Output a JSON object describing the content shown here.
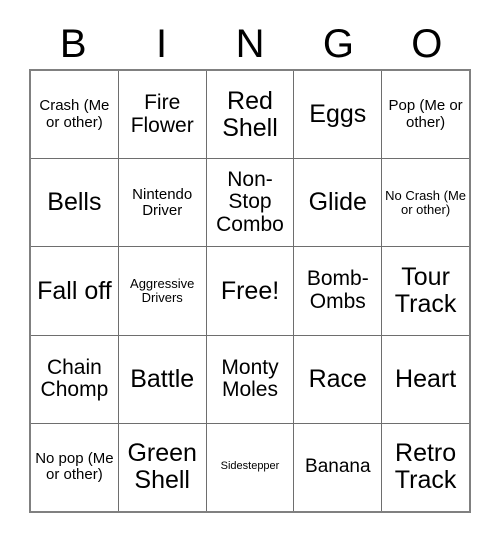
{
  "header": {
    "letters": [
      "B",
      "I",
      "N",
      "G",
      "O"
    ]
  },
  "grid": {
    "columns": 5,
    "rows": 5,
    "cells": [
      [
        {
          "text": "Crash (Me or other)",
          "size": "md"
        },
        {
          "text": "Fire Flower",
          "size": "xl"
        },
        {
          "text": "Red Shell",
          "size": "xxl"
        },
        {
          "text": "Eggs",
          "size": "xxl"
        },
        {
          "text": "Pop (Me or other)",
          "size": "md"
        }
      ],
      [
        {
          "text": "Bells",
          "size": "xxl"
        },
        {
          "text": "Nintendo Driver",
          "size": "md"
        },
        {
          "text": "Non-Stop Combo",
          "size": "xl"
        },
        {
          "text": "Glide",
          "size": "xxl"
        },
        {
          "text": "No Crash (Me or other)",
          "size": "sm"
        }
      ],
      [
        {
          "text": "Fall off",
          "size": "xxl"
        },
        {
          "text": "Aggressive Drivers",
          "size": "sm"
        },
        {
          "text": "Free!",
          "size": "xxl"
        },
        {
          "text": "Bomb-Ombs",
          "size": "xl"
        },
        {
          "text": "Tour Track",
          "size": "xxl"
        }
      ],
      [
        {
          "text": "Chain Chomp",
          "size": "xl"
        },
        {
          "text": "Battle",
          "size": "xxl"
        },
        {
          "text": "Monty Moles",
          "size": "xl"
        },
        {
          "text": "Race",
          "size": "xxl"
        },
        {
          "text": "Heart",
          "size": "xxl"
        }
      ],
      [
        {
          "text": "No pop (Me or other)",
          "size": "md"
        },
        {
          "text": "Green Shell",
          "size": "xxl"
        },
        {
          "text": "Sidestepper",
          "size": "xs"
        },
        {
          "text": "Banana",
          "size": "lg"
        },
        {
          "text": "Retro Track",
          "size": "xxl"
        }
      ]
    ]
  },
  "colors": {
    "background": "#ffffff",
    "text": "#000000",
    "grid_line": "#6e6e6e",
    "grid_border": "#808080"
  }
}
